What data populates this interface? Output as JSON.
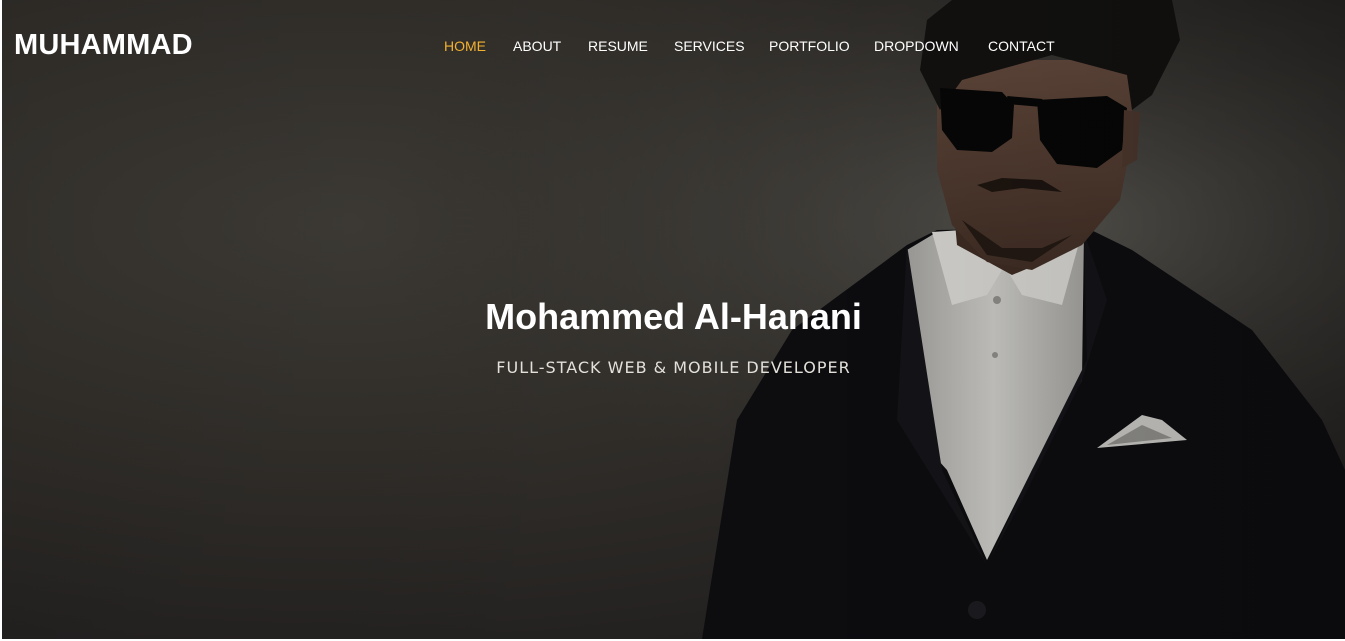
{
  "brand": {
    "logo": "MUHAMMAD"
  },
  "nav": {
    "items": [
      {
        "label": "HOME",
        "active": true
      },
      {
        "label": "ABOUT",
        "active": false
      },
      {
        "label": "RESUME",
        "active": false
      },
      {
        "label": "SERVICES",
        "active": false
      },
      {
        "label": "PORTFOLIO",
        "active": false
      },
      {
        "label": "DROPDOWN",
        "active": false
      },
      {
        "label": "CONTACT",
        "active": false
      }
    ]
  },
  "hero": {
    "name": "Mohammed Al-Hanani",
    "role": "FULL-STACK WEB & MOBILE DEVELOPER"
  },
  "colors": {
    "accent": "#f2b12f",
    "background": "#2e2b27",
    "text": "#ffffff"
  }
}
